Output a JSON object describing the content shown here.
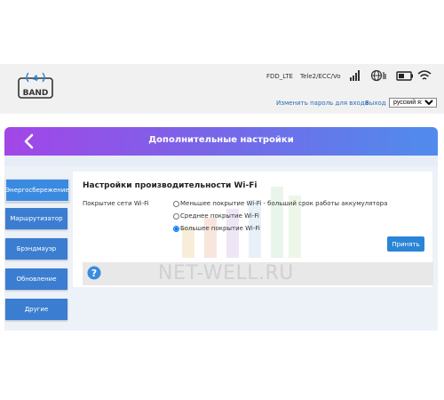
{
  "logo": {
    "text": "BAND",
    "number": "4"
  },
  "status": {
    "network": "FDD_LTE",
    "operator": "Tele2/ECC/Vo"
  },
  "icons": [
    "signal-icon",
    "globe-icon",
    "battery-icon",
    "wifi-icon",
    "back-icon",
    "help-icon"
  ],
  "top_links": {
    "change_password": "Изменить пароль для входа",
    "logout": "Выход"
  },
  "language": {
    "selected": "русский язык"
  },
  "page": {
    "title": "Дополнительные настройки"
  },
  "sidebar": {
    "items": [
      {
        "label": "Энергосбережение",
        "active": true
      },
      {
        "label": "Маршрутизатор",
        "active": false
      },
      {
        "label": "Брэндмауэр",
        "active": false
      },
      {
        "label": "Обновление",
        "active": false
      },
      {
        "label": "Другие",
        "active": false
      }
    ]
  },
  "section": {
    "title": "Настройки производительности Wi-Fi",
    "field_label": "Покрытие сети Wi-Fi",
    "options": [
      {
        "label": "Меньшее покрытие Wi-Fi - больший срок работы аккумулятора",
        "checked": false
      },
      {
        "label": "Среднее покрытие Wi-Fi",
        "checked": false
      },
      {
        "label": "Большее покрытие Wi-Fi",
        "checked": true
      }
    ],
    "apply_label": "Принять"
  },
  "watermark": "NET-WELL.RU",
  "colors": {
    "accent": "#2b85d6",
    "header_start": "#a246e8",
    "header_end": "#4f8cec"
  }
}
